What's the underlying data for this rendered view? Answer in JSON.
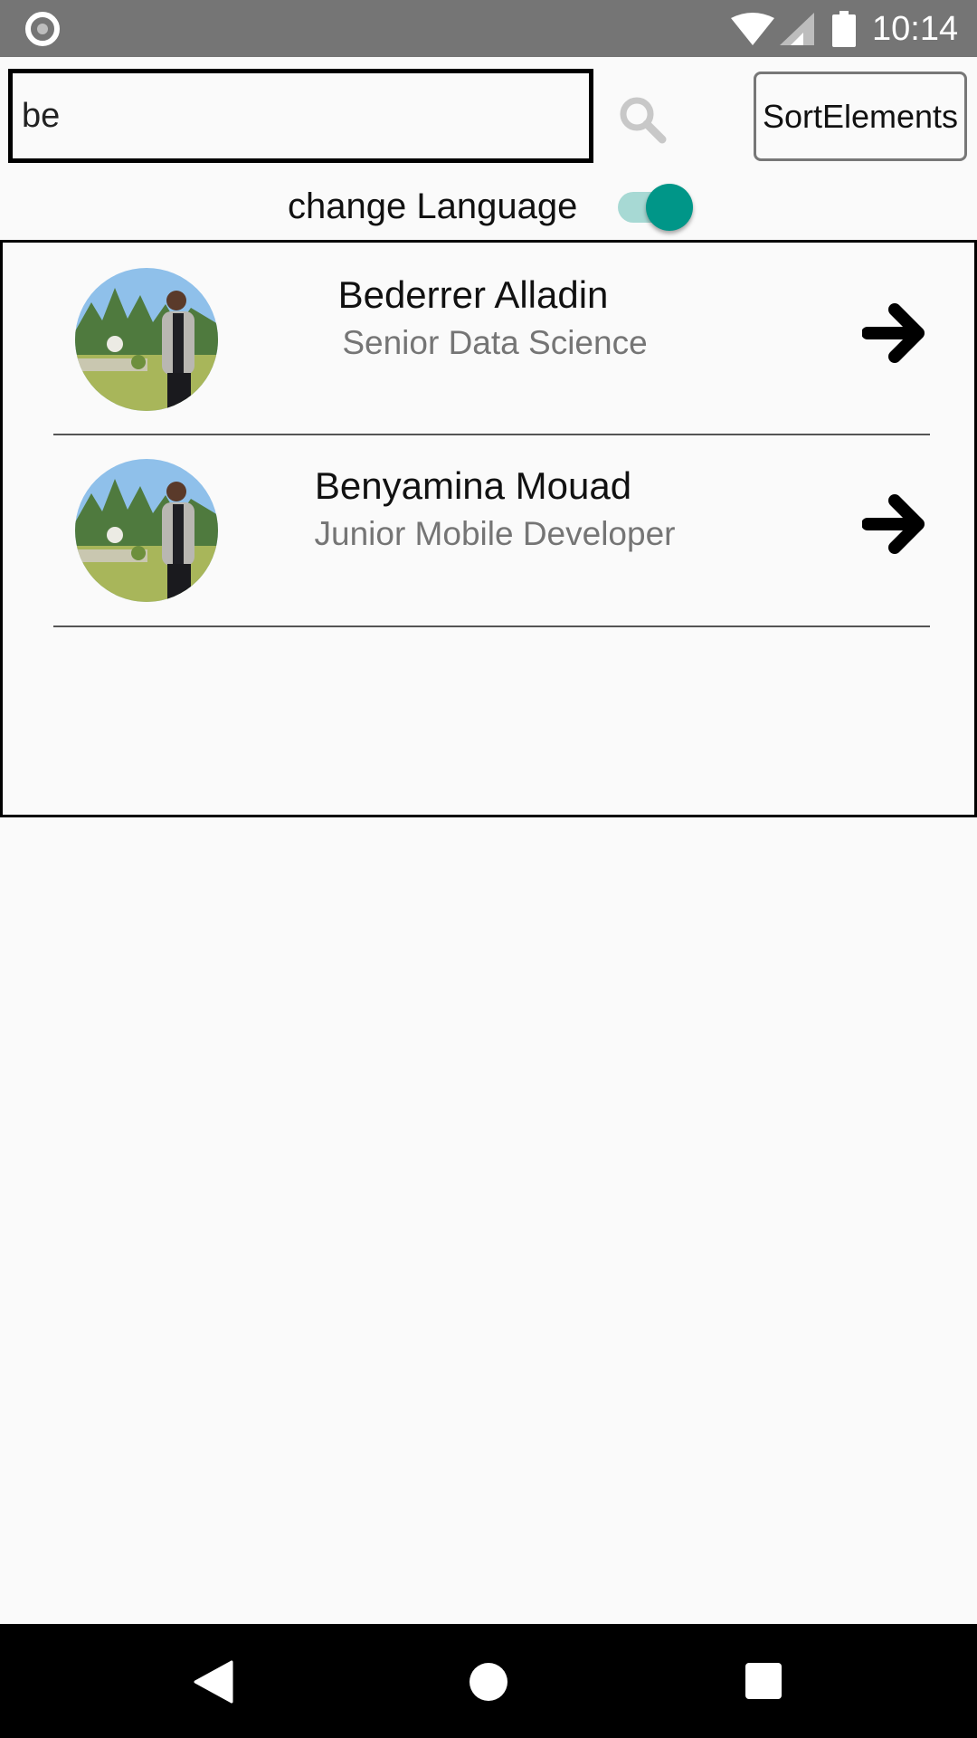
{
  "status_bar": {
    "time": "10:14",
    "icons": [
      "record-dot-icon",
      "wifi-icon",
      "signal-icon",
      "battery-icon"
    ]
  },
  "search": {
    "value": "be",
    "placeholder": "",
    "icon": "search-icon"
  },
  "sort_button": {
    "label": "SortElements"
  },
  "language": {
    "label": "change Language",
    "toggle_on": true
  },
  "people": [
    {
      "name": "Bederrer Alladin",
      "role": "Senior Data Science",
      "icon": "arrow-right-icon"
    },
    {
      "name": "Benyamina Mouad",
      "role": "Junior Mobile Developer",
      "icon": "arrow-right-icon"
    }
  ],
  "nav_bar": {
    "icons": [
      "back-icon",
      "home-icon",
      "recents-icon"
    ]
  },
  "colors": {
    "status_bar": "#757575",
    "accent": "#009688",
    "accent_track": "#a7d9d4",
    "secondary_text": "#757575",
    "background": "#fafafa"
  }
}
